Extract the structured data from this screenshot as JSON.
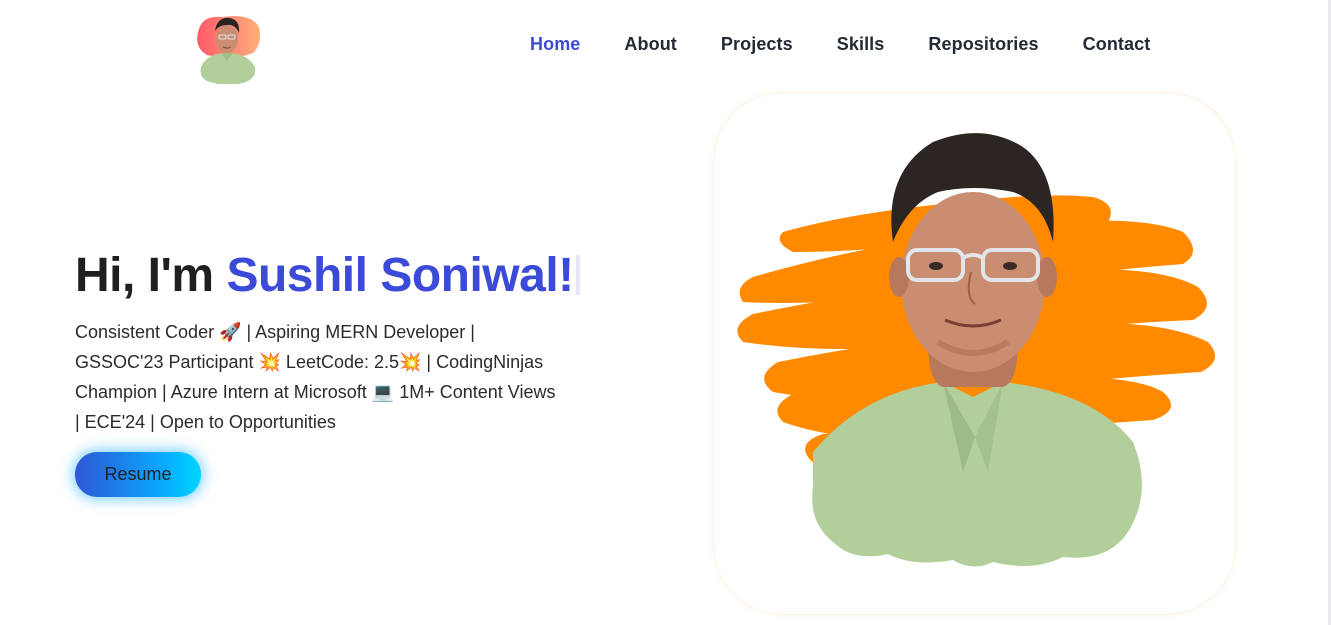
{
  "header": {
    "logo_alt": "profile avatar",
    "nav": [
      {
        "label": "Home",
        "active": true
      },
      {
        "label": "About",
        "active": false
      },
      {
        "label": "Projects",
        "active": false
      },
      {
        "label": "Skills",
        "active": false
      },
      {
        "label": "Repositories",
        "active": false
      },
      {
        "label": "Contact",
        "active": false
      }
    ]
  },
  "hero": {
    "greeting": "Hi, I'm",
    "name": "Sushil Soniwal!",
    "description_lines": [
      "Consistent Coder 🚀 | Aspiring MERN Developer |",
      "GSSOC'23 Participant 💥 LeetCode: 2.5💥 | CodingNinjas",
      "Champion | Azure Intern at Microsoft 💻 1M+ Content Views",
      "| ECE'24 | Open to Opportunities"
    ],
    "resume_label": "Resume"
  },
  "colors": {
    "accent": "#3b4bd8",
    "brush": "#ff8a00",
    "shirt": "#b2cf9b",
    "button_start": "#2f57d6",
    "button_end": "#00d6ff"
  },
  "icons": {
    "rocket": "rocket-icon",
    "explosion": "explosion-icon",
    "laptop": "laptop-icon"
  }
}
